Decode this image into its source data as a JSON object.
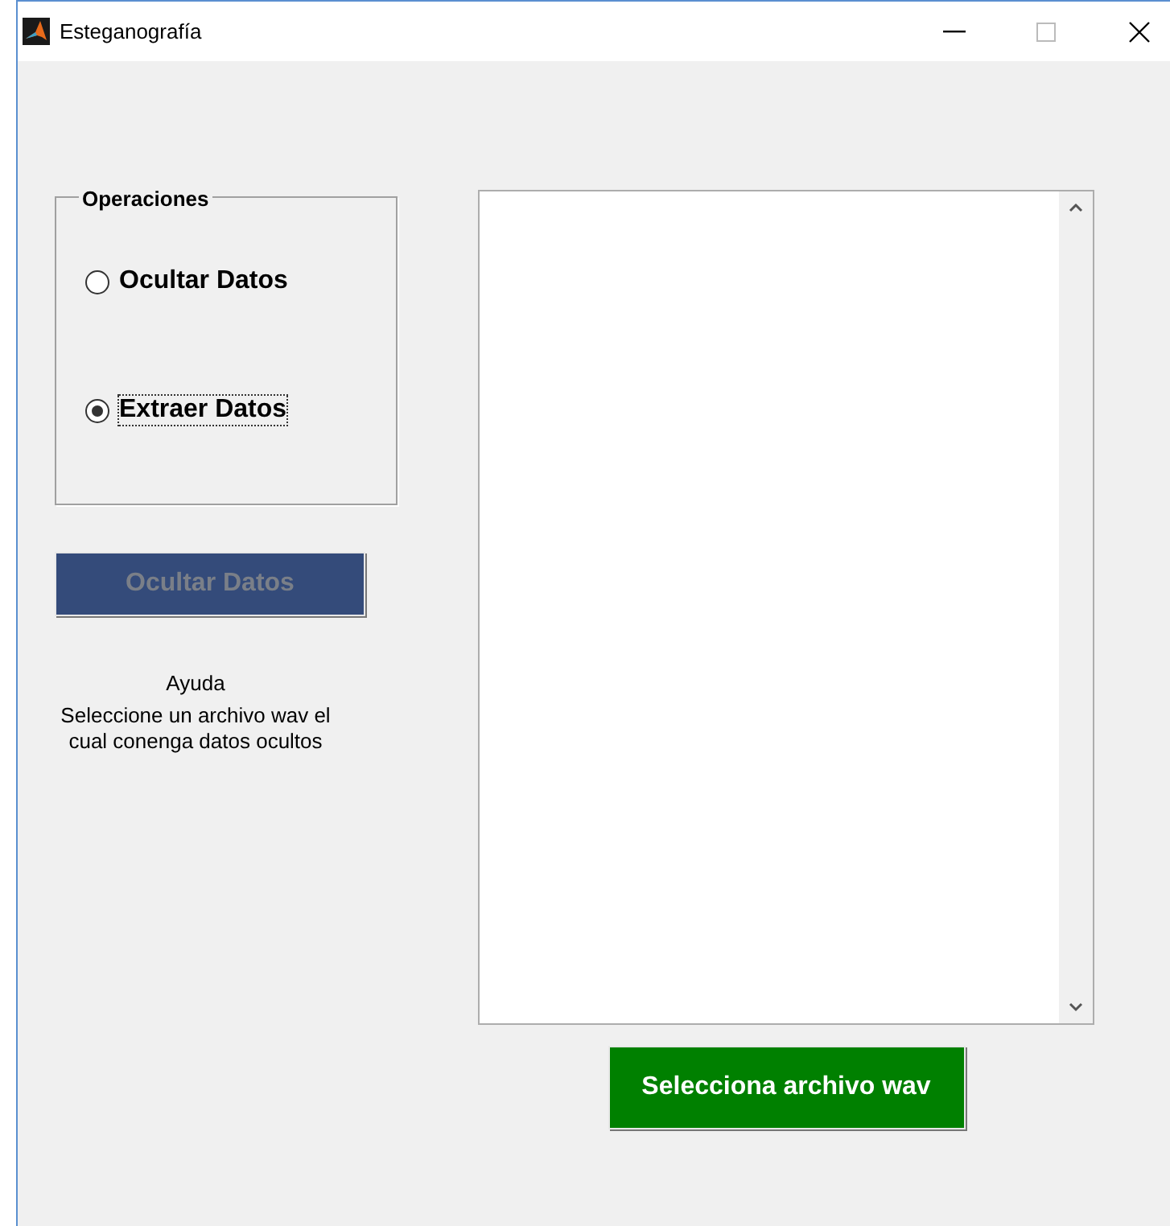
{
  "window": {
    "title": "Esteganografía"
  },
  "operations": {
    "title": "Operaciones",
    "options": [
      {
        "label": "Ocultar Datos",
        "selected": false
      },
      {
        "label": "Extraer Datos",
        "selected": true
      }
    ]
  },
  "action_button": {
    "label": "Ocultar Datos",
    "disabled": true
  },
  "help": {
    "title": "Ayuda",
    "text": "Seleccione un archivo wav el cual conenga datos ocultos"
  },
  "select_button": {
    "label": "Selecciona archivo wav"
  }
}
